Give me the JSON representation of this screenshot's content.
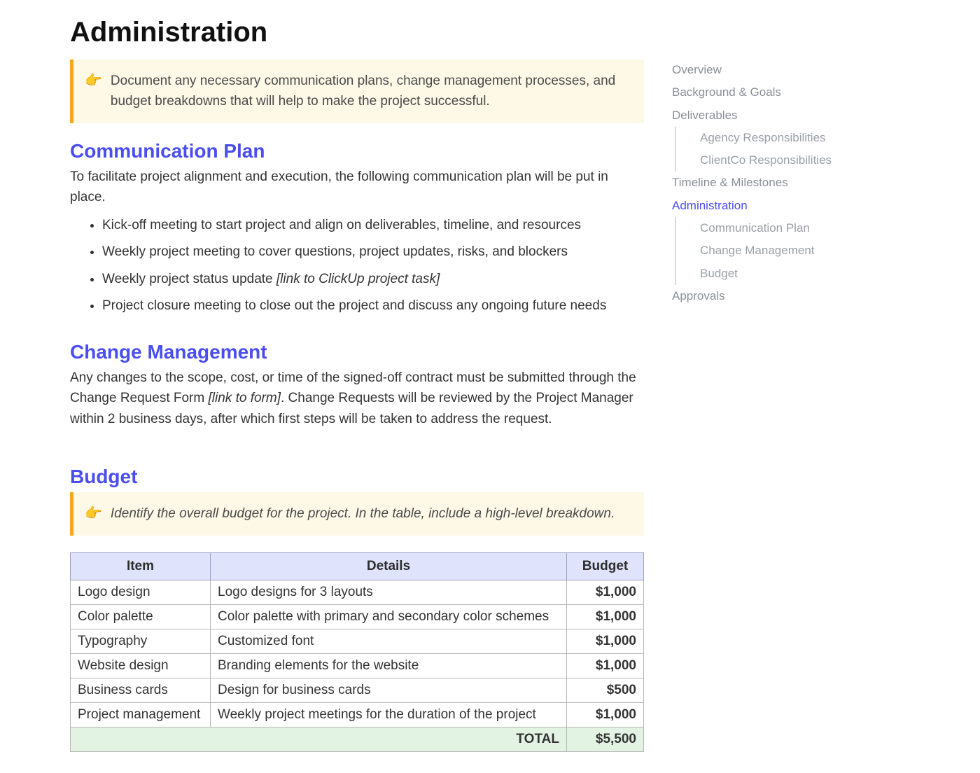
{
  "title": "Administration",
  "callout1": "Document any necessary communication plans, change management processes, and budget breakdowns that will help to make the project successful.",
  "sections": {
    "commPlan": {
      "heading": "Communication Plan",
      "intro": "To facilitate project alignment and execution, the following communication plan will be put in place.",
      "items": [
        {
          "text": "Kick-off meeting to start project and align on deliverables, timeline, and resources",
          "link": ""
        },
        {
          "text": "Weekly project meeting to cover questions, project updates, risks, and blockers",
          "link": ""
        },
        {
          "text": "Weekly project status update ",
          "link": "[link to ClickUp project task]"
        },
        {
          "text": "Project closure meeting to close out the project and discuss any ongoing future needs",
          "link": ""
        }
      ]
    },
    "changeMgmt": {
      "heading": "Change Management",
      "body_pre": "Any changes to the scope, cost, or time of the signed-off contract must be submitted through the Change Request Form ",
      "body_link": "[link to form]",
      "body_post": ". Change Requests will be reviewed by the Project Manager within 2 business days, after which first steps will be taken to address the request."
    },
    "budget": {
      "heading": "Budget",
      "callout": "Identify the overall budget for the project. In the table, include a high-level breakdown.",
      "columns": [
        "Item",
        "Details",
        "Budget"
      ],
      "rows": [
        {
          "item": "Logo design",
          "details": "Logo designs for 3 layouts",
          "budget": "$1,000"
        },
        {
          "item": "Color palette",
          "details": "Color palette with primary and secondary color schemes",
          "budget": "$1,000"
        },
        {
          "item": "Typography",
          "details": "Customized font",
          "budget": "$1,000"
        },
        {
          "item": "Website design",
          "details": "Branding elements for the website",
          "budget": "$1,000"
        },
        {
          "item": "Business cards",
          "details": "Design for business cards",
          "budget": "$500"
        },
        {
          "item": "Project management",
          "details": "Weekly project meetings for the duration of the project",
          "budget": "$1,000"
        }
      ],
      "total_label": "TOTAL",
      "total_amount": "$5,500"
    }
  },
  "nav": [
    {
      "label": "Overview",
      "level": 1,
      "active": false
    },
    {
      "label": "Background & Goals",
      "level": 1,
      "active": false
    },
    {
      "label": "Deliverables",
      "level": 1,
      "active": false
    },
    {
      "label": "Agency Responsibilities",
      "level": 2,
      "active": false
    },
    {
      "label": "ClientCo Responsibilities",
      "level": 2,
      "active": false
    },
    {
      "label": "Timeline & Milestones",
      "level": 1,
      "active": false
    },
    {
      "label": "Administration",
      "level": 1,
      "active": true
    },
    {
      "label": "Communication Plan",
      "level": 2,
      "active": false
    },
    {
      "label": "Change Management",
      "level": 2,
      "active": false
    },
    {
      "label": "Budget",
      "level": 2,
      "active": false
    },
    {
      "label": "Approvals",
      "level": 1,
      "active": false
    }
  ],
  "icons": {
    "hand": "👉"
  }
}
